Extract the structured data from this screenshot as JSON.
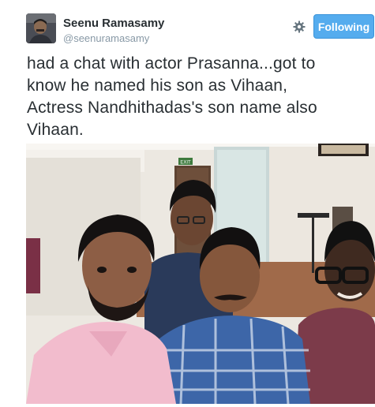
{
  "tweet": {
    "author_name": "Seenu Ramasamy",
    "author_handle": "@seenuramasamy",
    "follow_label": "Following",
    "text": "had a chat with actor Prasanna...got to\nknow he named his son as Vihaan,\nActress Nandhithadas's son name also\nVihaan."
  },
  "photo": {
    "exit_sign": "EXIT"
  },
  "colors": {
    "accent": "#55acee",
    "text": "#292f33",
    "muted": "#8899a6"
  },
  "icons": [
    "gear-icon",
    "avatar"
  ]
}
